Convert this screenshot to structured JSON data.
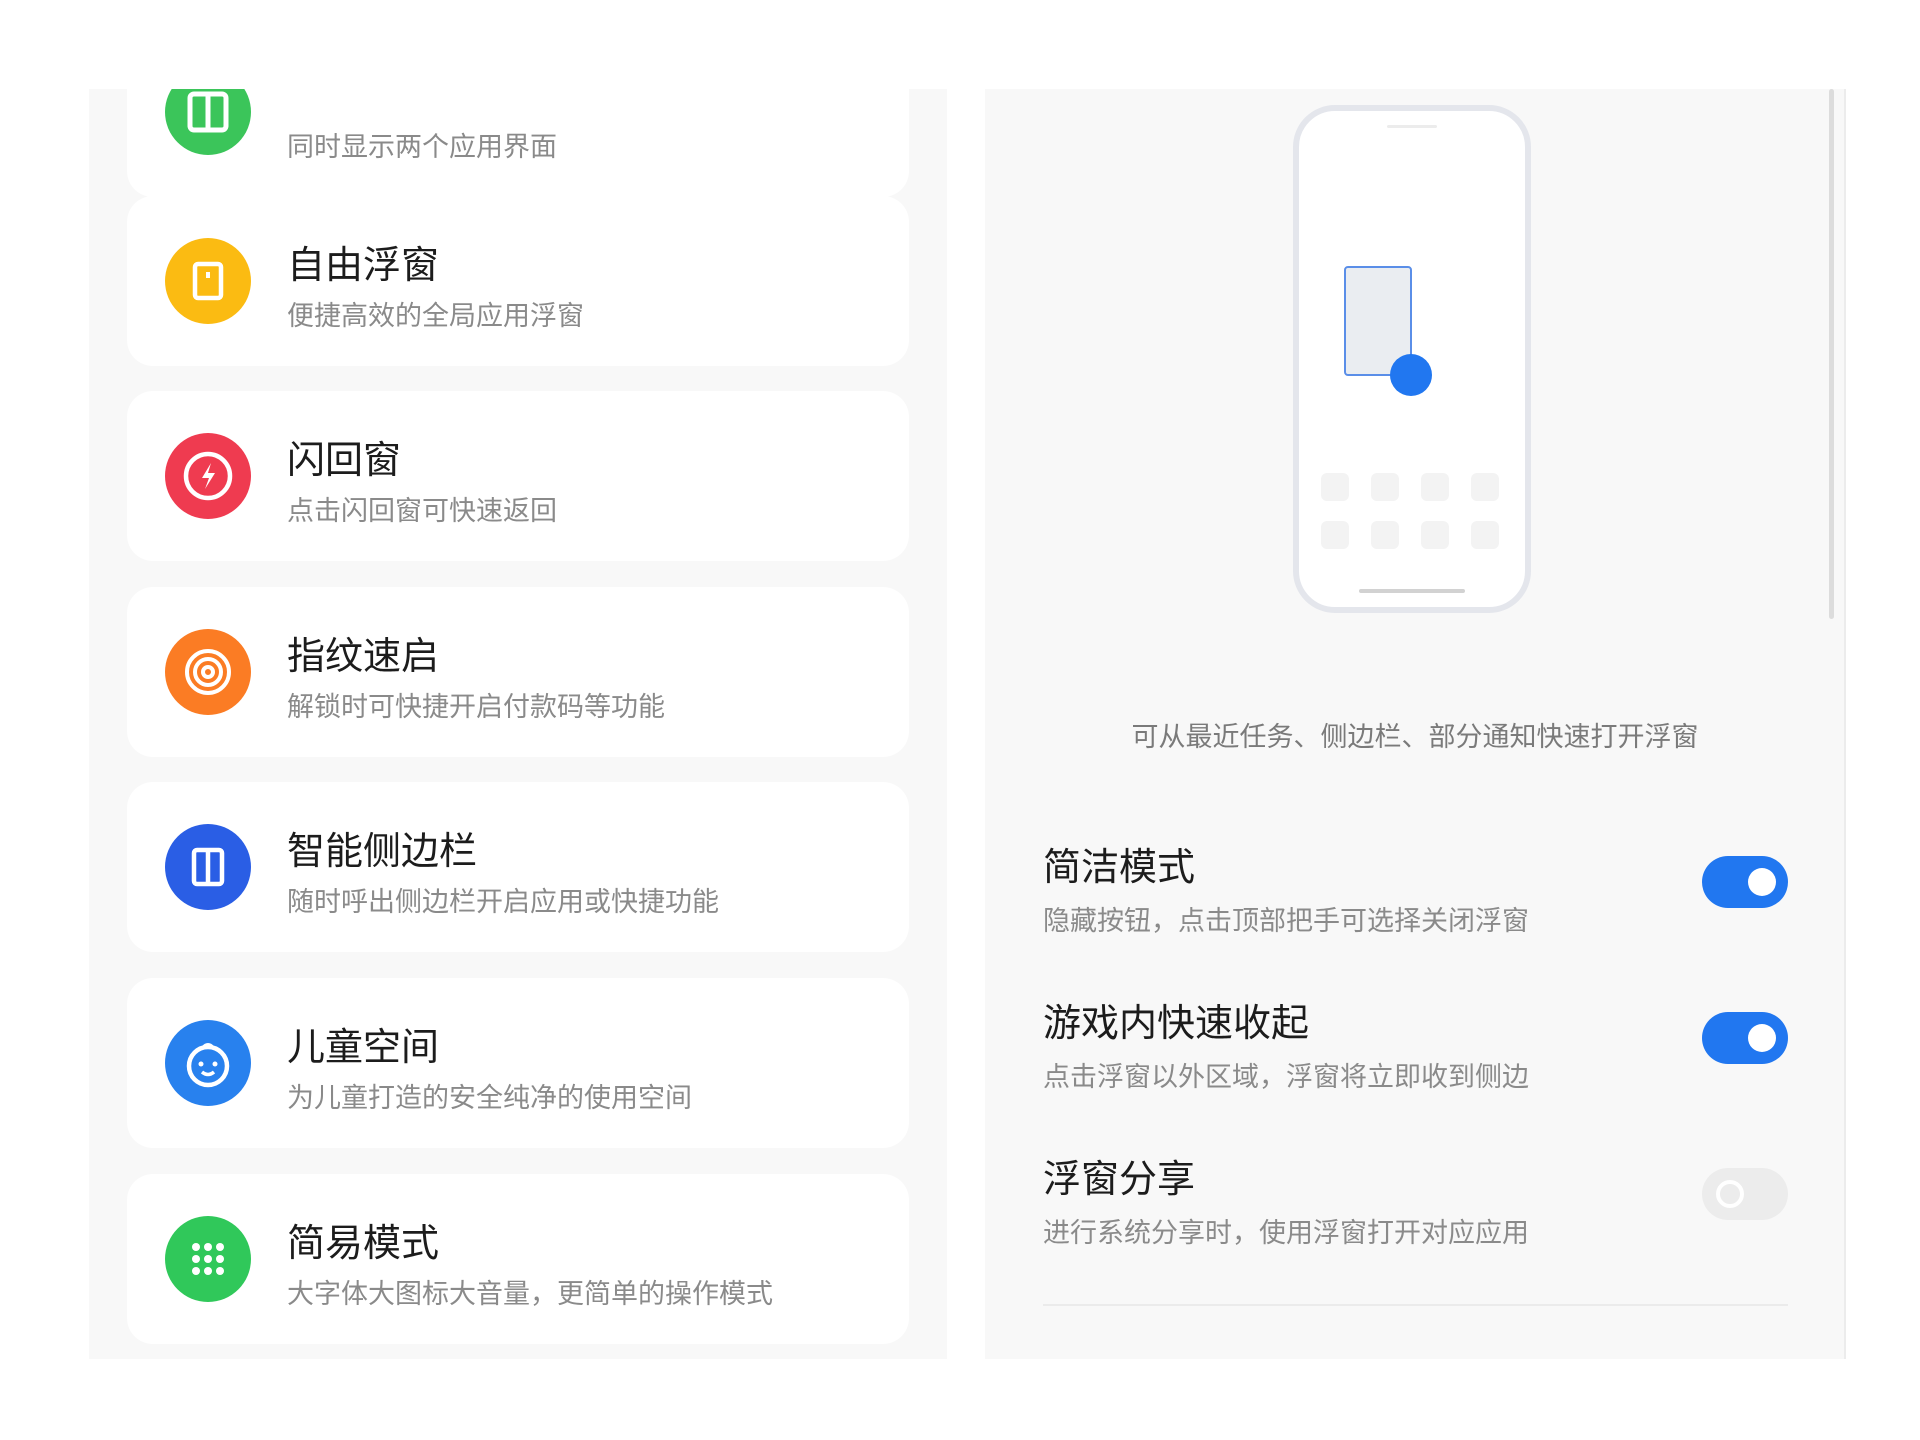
{
  "left_list": {
    "items": [
      {
        "title": "",
        "subtitle": "同时显示两个应用界面",
        "icon": "split-screen-icon",
        "color": "#3bc55a"
      },
      {
        "title": "自由浮窗",
        "subtitle": "便捷高效的全局应用浮窗",
        "icon": "floating-window-icon",
        "color": "#fbbb12"
      },
      {
        "title": "闪回窗",
        "subtitle": "点击闪回窗可快速返回",
        "icon": "flash-icon",
        "color": "#ef3b50"
      },
      {
        "title": "指纹速启",
        "subtitle": "解锁时可快捷开启付款码等功能",
        "icon": "fingerprint-icon",
        "color": "#fb7c24"
      },
      {
        "title": "智能侧边栏",
        "subtitle": "随时呼出侧边栏开启应用或快捷功能",
        "icon": "sidebar-icon",
        "color": "#2a5ee5"
      },
      {
        "title": "儿童空间",
        "subtitle": "为儿童打造的安全纯净的使用空间",
        "icon": "child-face-icon",
        "color": "#2881ee"
      },
      {
        "title": "简易模式",
        "subtitle": "大字体大图标大音量，更简单的操作模式",
        "icon": "grid-dots-icon",
        "color": "#30c85a"
      }
    ]
  },
  "detail": {
    "hint": "可从最近任务、侧边栏、部分通知快速打开浮窗",
    "settings": [
      {
        "title": "简洁模式",
        "subtitle": "隐藏按钮，点击顶部把手可选择关闭浮窗",
        "enabled": true
      },
      {
        "title": "游戏内快速收起",
        "subtitle": "点击浮窗以外区域，浮窗将立即收到侧边",
        "enabled": true
      },
      {
        "title": "浮窗分享",
        "subtitle": "进行系统分享时，使用浮窗打开对应应用",
        "enabled": false
      }
    ]
  },
  "colors": {
    "accent": "#2177f0",
    "toggle_off": "#ececec",
    "pane_bg": "#f8f8f8"
  }
}
